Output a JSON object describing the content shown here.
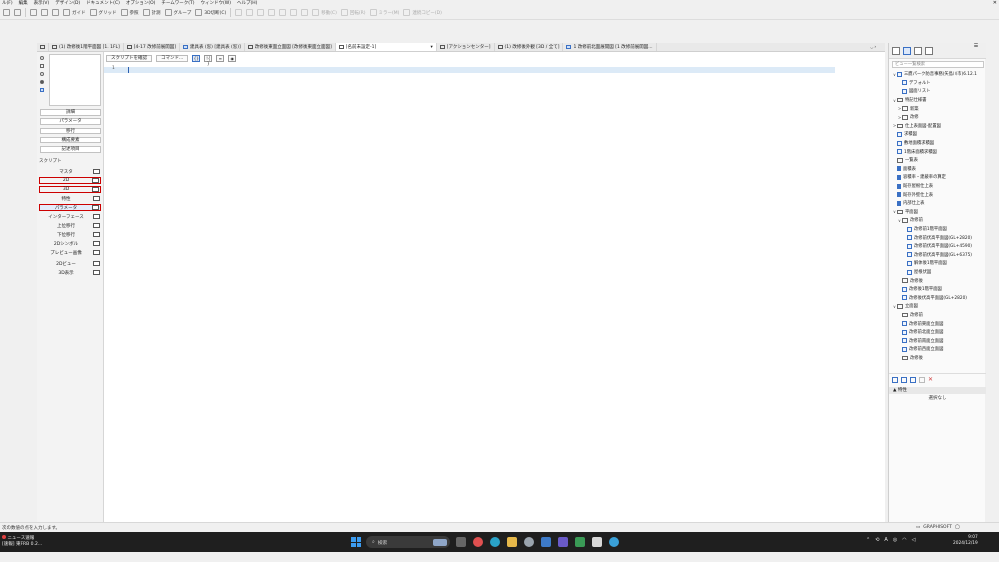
{
  "menu": {
    "items": [
      "ル(F)",
      "編集",
      "表示(V)",
      "デザイン(D)",
      "ドキュメント(C)",
      "オプション(O)",
      "チームワーク(T)",
      "ウィンドウ(W)",
      "ヘルプ(H)"
    ],
    "close_glyph": "✕"
  },
  "toolbar": {
    "guide_label": "ガイド",
    "grid_label": "グリッド",
    "reference_label": "参照",
    "measure_label": "計測",
    "group_label": "グループ",
    "cut_label": "3D切断(C)",
    "move_label": "移動(C)",
    "rotate_label": "回転(R)",
    "mirror_label": "ミラー(M)",
    "multicopy_label": "連続コピー(D)"
  },
  "tabs": [
    {
      "label": "(1) 改修後1階平面図 [1. 1FL]",
      "icon": "plan"
    },
    {
      "label": "[4-17 改修前展開図]",
      "icon": "sheet"
    },
    {
      "label": "建具表 (窓) [建具表 (窓)]",
      "icon": "schedule"
    },
    {
      "label": "改修後東面立面図 [改修後東面立面図]",
      "icon": "elevation"
    },
    {
      "label": "[名前未設定-1]",
      "icon": "script",
      "active": true
    },
    {
      "label": "[アクションセンター]",
      "icon": "action"
    },
    {
      "label": "(1) 改修後外観 [3D / 全て]",
      "icon": "3d"
    },
    {
      "label": "1 改修前北面展開図 [1 改修前展開図...",
      "icon": "section"
    }
  ],
  "script_editor": {
    "buttons": [
      "詳細",
      "パラメータ",
      "移行",
      "構成要素",
      "記述項目"
    ],
    "scripts_label": "スクリプト",
    "scripts": [
      {
        "label": "マスタ",
        "highlight": false
      },
      {
        "label": "2D",
        "highlight": true
      },
      {
        "label": "3D",
        "highlight": true
      },
      {
        "label": "特性",
        "highlight": false
      },
      {
        "label": "パラメータ",
        "highlight": true,
        "selected": true
      },
      {
        "label": "インターフェース",
        "highlight": false
      },
      {
        "label": "上位移行",
        "highlight": false
      },
      {
        "label": "下位移行",
        "highlight": false
      },
      {
        "label": "2Dシンボル",
        "highlight": false
      },
      {
        "label": "プレビュー画像",
        "highlight": false
      },
      {
        "label": "2Dビュー",
        "highlight": false
      },
      {
        "label": "3D表示",
        "highlight": false
      }
    ],
    "toolbar_check": "スクリプトを確認",
    "toolbar_command": "コマンド...",
    "toolbar_icon_1": "{}",
    "toolbar_icon_2": "!{ }",
    "toolbar_icon_3": "≡",
    "line_number": "1"
  },
  "navigator": {
    "search_placeholder": "ビュー一覧検索",
    "tree": [
      {
        "label": "三鷹パーク防音事務(矢島川市)6.12.1",
        "level": 0,
        "type": "view",
        "toggle": "∨"
      },
      {
        "label": "デフォルト",
        "level": 1,
        "type": "view",
        "toggle": ""
      },
      {
        "label": "図面リスト",
        "level": 1,
        "type": "view",
        "toggle": ""
      },
      {
        "label": "特記仕様書",
        "level": 0,
        "type": "folder",
        "toggle": "∨"
      },
      {
        "label": "新築",
        "level": 1,
        "type": "folder",
        "toggle": ">"
      },
      {
        "label": "改修",
        "level": 1,
        "type": "folder",
        "toggle": ">"
      },
      {
        "label": "仕上表面図-配置図",
        "level": 0,
        "type": "folder",
        "toggle": ">"
      },
      {
        "label": "求積図",
        "level": 0,
        "type": "view",
        "toggle": ""
      },
      {
        "label": "敷地面積求積図",
        "level": 0,
        "type": "view",
        "toggle": ""
      },
      {
        "label": "1階床面積求積図",
        "level": 0,
        "type": "view",
        "toggle": ""
      },
      {
        "label": "一覧表",
        "level": 0,
        "type": "folder",
        "toggle": ""
      },
      {
        "label": "面積表",
        "level": 0,
        "type": "list",
        "toggle": ""
      },
      {
        "label": "容積率・建蔽率の算定",
        "level": 0,
        "type": "list",
        "toggle": ""
      },
      {
        "label": "既存屋根仕上表",
        "level": 0,
        "type": "list",
        "toggle": ""
      },
      {
        "label": "既存外壁仕上表",
        "level": 0,
        "type": "list",
        "toggle": ""
      },
      {
        "label": "内部仕上表",
        "level": 0,
        "type": "list",
        "toggle": ""
      },
      {
        "label": "平面図",
        "level": 0,
        "type": "folder",
        "toggle": "∨"
      },
      {
        "label": "改修前",
        "level": 1,
        "type": "folder",
        "toggle": "∨"
      },
      {
        "label": "改修前1階平面図",
        "level": 2,
        "type": "view",
        "toggle": ""
      },
      {
        "label": "改修前伏高平面図(GL+2820)",
        "level": 2,
        "type": "view",
        "toggle": ""
      },
      {
        "label": "改修前伏高平面図(GL+4590)",
        "level": 2,
        "type": "view",
        "toggle": ""
      },
      {
        "label": "改修前伏高平面図(GL+6375)",
        "level": 2,
        "type": "view",
        "toggle": ""
      },
      {
        "label": "解体後1階平面図",
        "level": 2,
        "type": "view",
        "toggle": ""
      },
      {
        "label": "屋根伏図",
        "level": 2,
        "type": "view",
        "toggle": ""
      },
      {
        "label": "改修後",
        "level": 1,
        "type": "folder",
        "toggle": ""
      },
      {
        "label": "改修後1階平面図",
        "level": 1,
        "type": "view",
        "toggle": ""
      },
      {
        "label": "改修後伏高平面図(GL+2820)",
        "level": 1,
        "type": "view",
        "toggle": ""
      },
      {
        "label": "立面図",
        "level": 0,
        "type": "folder",
        "toggle": "∨"
      },
      {
        "label": "改修前",
        "level": 1,
        "type": "folder",
        "toggle": ""
      },
      {
        "label": "改修前東面立面図",
        "level": 1,
        "type": "view",
        "toggle": ""
      },
      {
        "label": "改修前北面立面図",
        "level": 1,
        "type": "view",
        "toggle": ""
      },
      {
        "label": "改修前南面立面図",
        "level": 1,
        "type": "view",
        "toggle": ""
      },
      {
        "label": "改修前西面立面図",
        "level": 1,
        "type": "view",
        "toggle": ""
      },
      {
        "label": "改修後",
        "level": 1,
        "type": "folder",
        "toggle": ""
      }
    ],
    "properties_header": "特性",
    "properties_value": "選択なし"
  },
  "status": {
    "message": "次の数値の点を入力します。",
    "brand": "GRAPHISOFT"
  },
  "taskbar": {
    "news_title": "ニュース速報",
    "news_body": "[速報] 東FRB 0.2...",
    "search_placeholder": "検索",
    "time": "9:07",
    "date": "2024/12/19",
    "tray_ime": "A"
  },
  "colors": {
    "highlight_red": "#cc0000",
    "accent_blue": "#3a70c4",
    "code_line": "#dceaf7",
    "taskbar": "#1f1f1f"
  }
}
